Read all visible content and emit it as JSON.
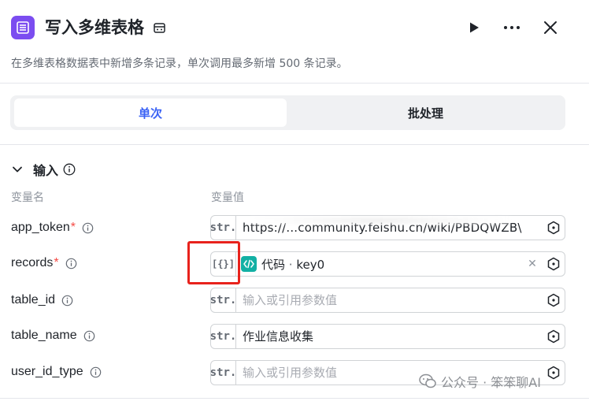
{
  "header": {
    "title": "写入多维表格",
    "description": "在多维表格数据表中新增多条记录，单次调用最多新增 500 条记录。"
  },
  "tabs": [
    {
      "label": "单次",
      "active": true
    },
    {
      "label": "批处理",
      "active": false
    }
  ],
  "section": {
    "title": "输入",
    "col_name": "变量名",
    "col_value": "变量值"
  },
  "params": [
    {
      "name": "app_token",
      "required": true,
      "type": "str.",
      "value": "https://...community.feishu.cn/wiki/PBDQWZB\\",
      "placeholder": ""
    },
    {
      "name": "records",
      "required": true,
      "type": "[{}]",
      "ref_name": "代码",
      "ref_separator": "·",
      "ref_key": "key0"
    },
    {
      "name": "table_id",
      "required": false,
      "type": "str.",
      "value": "",
      "placeholder": "输入或引用参数值"
    },
    {
      "name": "table_name",
      "required": false,
      "type": "str.",
      "value": "作业信息收集",
      "placeholder": ""
    },
    {
      "name": "user_id_type",
      "required": false,
      "type": "str.",
      "value": "",
      "placeholder": "输入或引用参数值"
    }
  ],
  "watermark": "公众号 · 笨笨聊AI",
  "colors": {
    "accent": "#3b63f5",
    "app_icon": "#7b4df0",
    "code_icon": "#13b0a4",
    "required": "#f54a45",
    "highlight": "#e8221c"
  }
}
